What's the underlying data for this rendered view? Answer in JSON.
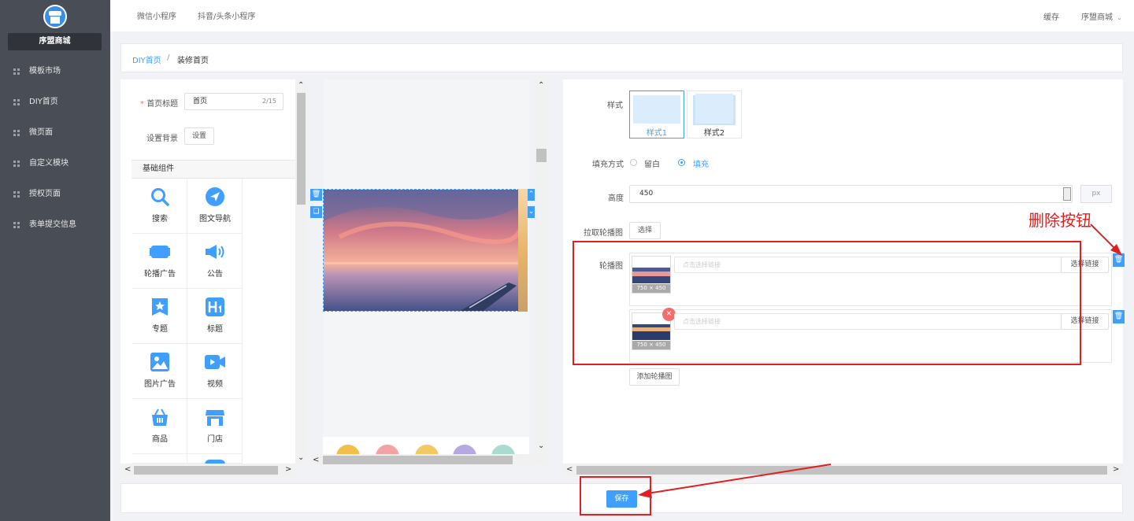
{
  "sidebar": {
    "store_name": "序盟商城",
    "items": [
      {
        "label": "模板市场"
      },
      {
        "label": "DIY首页"
      },
      {
        "label": "微页面"
      },
      {
        "label": "自定义模块"
      },
      {
        "label": "授权页面"
      },
      {
        "label": "表单提交信息"
      }
    ]
  },
  "topbar": {
    "tabs": [
      {
        "label": "微信小程序"
      },
      {
        "label": "抖音/头条小程序"
      }
    ],
    "cache": "缓存",
    "store_menu": "序盟商城",
    "store_menu_icon": "chevron-down-icon"
  },
  "breadcrumb": {
    "root": "DIY首页",
    "separator": "/",
    "current": "装修首页"
  },
  "left_panel": {
    "title_label_req": "*",
    "title_label": "首页标题",
    "title_value": "首页",
    "title_count": "2/15",
    "bg_label": "设置背景",
    "bg_button": "设置",
    "section": "基础组件",
    "components": [
      {
        "label": "搜索",
        "icon": "search-icon"
      },
      {
        "label": "图文导航",
        "icon": "navigation-icon"
      },
      {
        "label": "轮播广告",
        "icon": "carousel-icon"
      },
      {
        "label": "公告",
        "icon": "speaker-icon"
      },
      {
        "label": "专题",
        "icon": "topic-icon"
      },
      {
        "label": "标题",
        "icon": "heading-icon"
      },
      {
        "label": "图片广告",
        "icon": "image-icon"
      },
      {
        "label": "视频",
        "icon": "video-icon"
      },
      {
        "label": "商品",
        "icon": "basket-icon"
      },
      {
        "label": "门店",
        "icon": "store-icon"
      }
    ]
  },
  "right_panel": {
    "style_label": "样式",
    "styles": [
      {
        "label": "样式1",
        "selected": true
      },
      {
        "label": "样式2",
        "selected": false
      }
    ],
    "fill_label": "填充方式",
    "fill_options": [
      {
        "label": "留白",
        "selected": false
      },
      {
        "label": "填充",
        "selected": true
      }
    ],
    "height_label": "高度",
    "height_value": "450",
    "height_unit": "px",
    "pull_label": "拉取轮播图",
    "pull_button": "选择",
    "carousel_label": "轮播图",
    "slides": [
      {
        "size": "750 × 450",
        "link_placeholder": "点击选择链接",
        "link_button": "选择链接"
      },
      {
        "size": "750 × 450",
        "link_placeholder": "点击选择链接",
        "link_button": "选择链接"
      }
    ],
    "add_button": "添加轮播图"
  },
  "save_button": "保存",
  "annotation": {
    "delete_label": "删除按钮"
  },
  "colors": {
    "primary": "#409eff",
    "sidebar": "#494d55",
    "danger": "#f56c6c",
    "annotation": "#e02020"
  }
}
